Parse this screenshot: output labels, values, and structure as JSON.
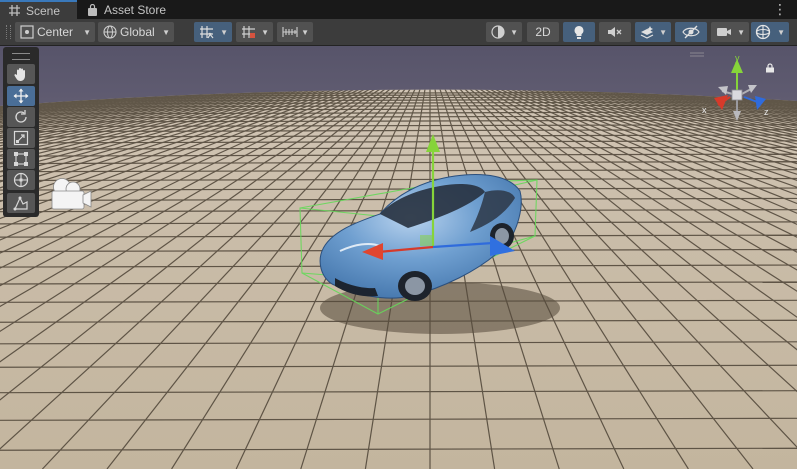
{
  "tabs": [
    {
      "label": "Scene",
      "icon": "grid-icon",
      "active": true
    },
    {
      "label": "Asset Store",
      "icon": "shopping-bag-icon",
      "active": false
    }
  ],
  "toolbar": {
    "pivot_mode": "Center",
    "pivot_rotation": "Global",
    "view_2d_label": "2D"
  },
  "gizmo": {
    "x_label": "x",
    "y_label": "y",
    "z_label": "z"
  },
  "colors": {
    "toolbar_bg": "#3c3c3c",
    "button_bg": "#515151",
    "button_active": "#46607c",
    "tool_active": "#4a6e97",
    "ground": "#c6b9a5",
    "sky_top": "#5a5566",
    "axis_x": "#d63a2a",
    "axis_y": "#86d43a",
    "axis_z": "#2f6bdc"
  }
}
